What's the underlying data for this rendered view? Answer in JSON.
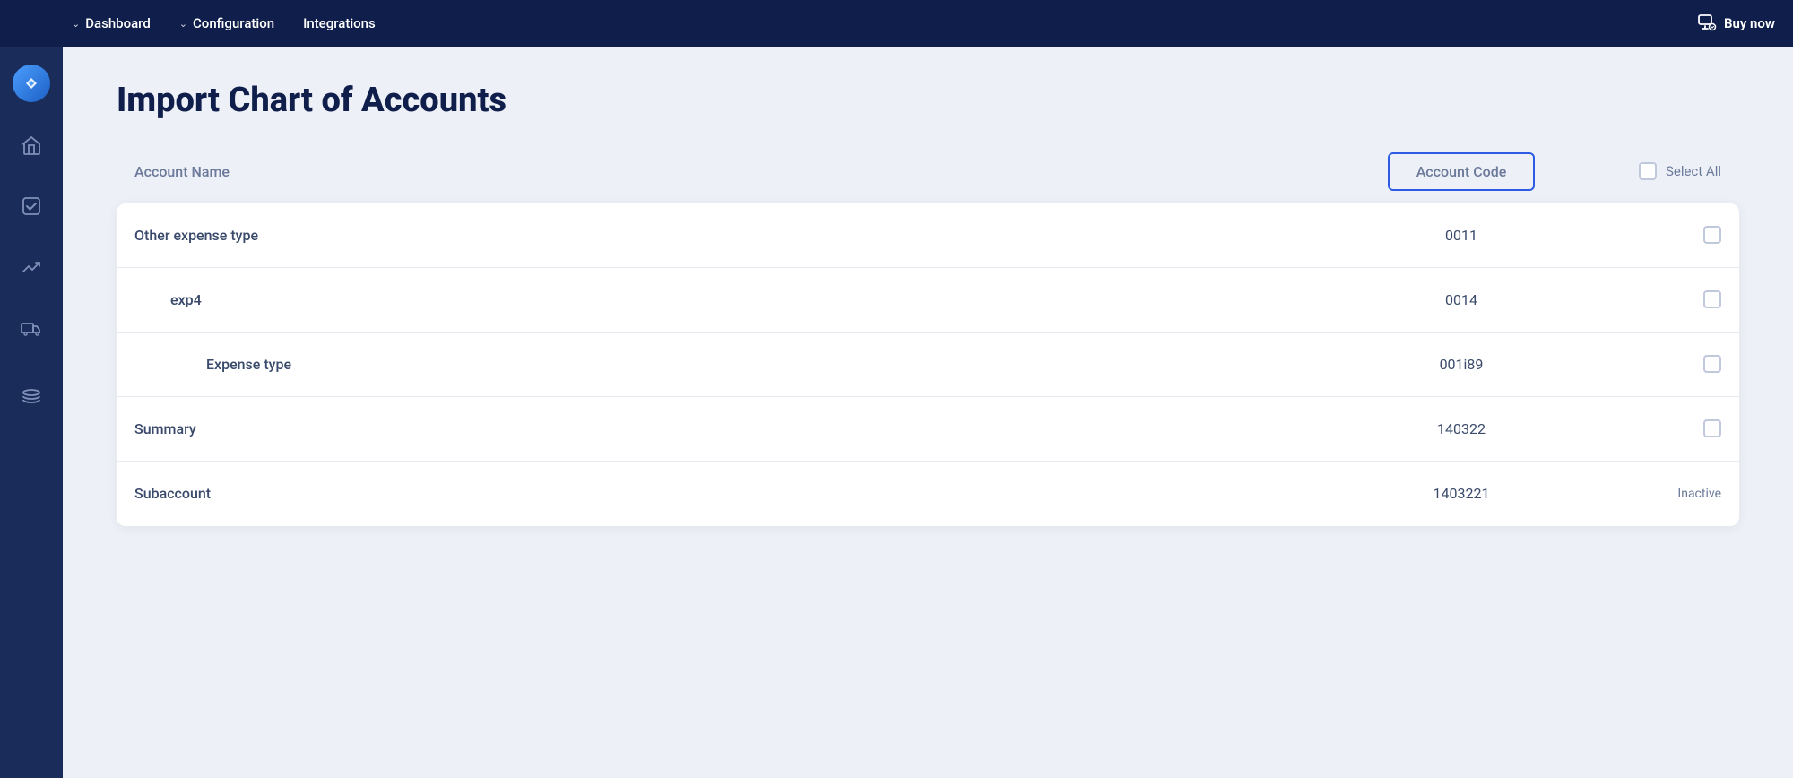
{
  "topNav": {
    "items": [
      {
        "label": "Dashboard",
        "hasChevron": true
      },
      {
        "label": "Configuration",
        "hasChevron": true
      },
      {
        "label": "Integrations",
        "hasChevron": false
      }
    ],
    "buyNow": "Buy now"
  },
  "sidebar": {
    "icons": [
      {
        "name": "home-icon",
        "symbol": "⌂"
      },
      {
        "name": "task-icon",
        "symbol": "✓"
      },
      {
        "name": "chart-icon",
        "symbol": "↗"
      },
      {
        "name": "delivery-icon",
        "symbol": "🚚"
      },
      {
        "name": "layers-icon",
        "symbol": "⊟"
      }
    ]
  },
  "page": {
    "title": "Import Chart of Accounts",
    "table": {
      "columns": {
        "accountName": "Account Name",
        "accountCode": "Account Code",
        "selectAll": "Select All"
      },
      "rows": [
        {
          "id": 1,
          "name": "Other expense type",
          "code": "0011",
          "indent": 0,
          "status": ""
        },
        {
          "id": 2,
          "name": "exp4",
          "code": "0014",
          "indent": 1,
          "status": ""
        },
        {
          "id": 3,
          "name": "Expense type",
          "code": "001i89",
          "indent": 2,
          "status": ""
        },
        {
          "id": 4,
          "name": "Summary",
          "code": "140322",
          "indent": 0,
          "status": ""
        },
        {
          "id": 5,
          "name": "Subaccount",
          "code": "1403221",
          "indent": 0,
          "status": "Inactive"
        }
      ]
    }
  }
}
